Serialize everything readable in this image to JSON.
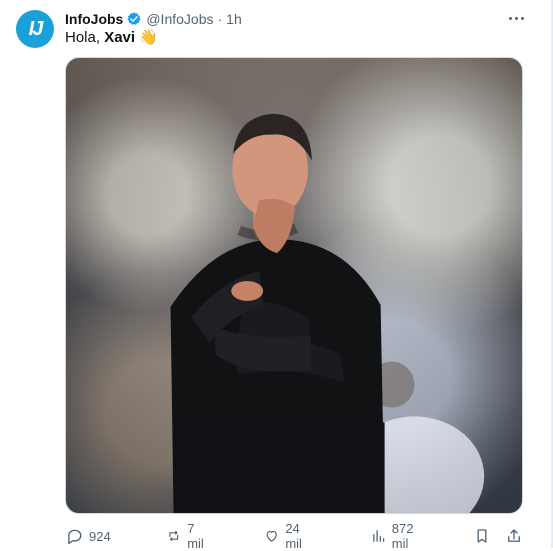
{
  "tweet": {
    "author_name": "InfoJobs",
    "handle": "@InfoJobs",
    "separator": "·",
    "time": "1h",
    "avatar_text": "IJ",
    "text_prefix": "Hola, ",
    "text_bold": "Xavi",
    "emoji": "👋"
  },
  "icons": {
    "verified": "verified-badge-icon",
    "more": "more-options-icon",
    "reply": "reply-icon",
    "retweet": "retweet-icon",
    "like": "heart-icon",
    "views": "views-icon",
    "bookmark": "bookmark-icon",
    "share": "share-icon"
  },
  "metrics": {
    "replies": "924",
    "retweets": "7 mil",
    "likes": "24 mil",
    "views": "872 mil"
  },
  "colors": {
    "brand": "#1ba0d9",
    "verified": "#1d9bf0",
    "text": "#0f1419",
    "muted": "#536471"
  }
}
